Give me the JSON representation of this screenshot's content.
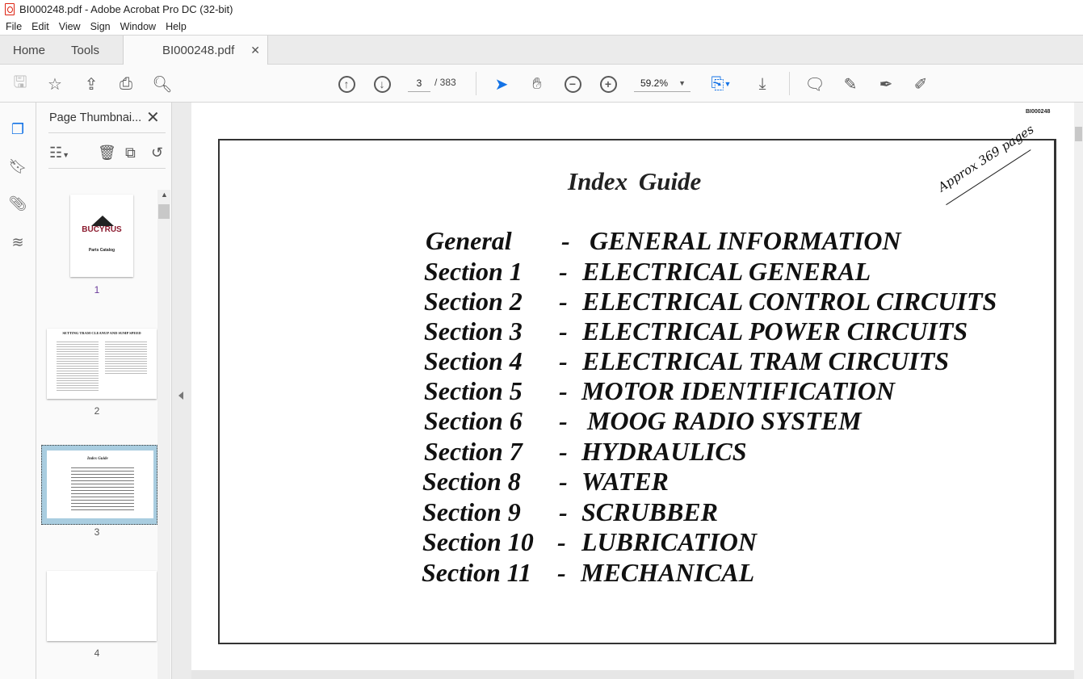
{
  "window": {
    "title": "BI000248.pdf - Adobe Acrobat Pro DC (32-bit)"
  },
  "menu": [
    "File",
    "Edit",
    "View",
    "Sign",
    "Window",
    "Help"
  ],
  "tabs": {
    "home": "Home",
    "tools": "Tools",
    "document": "BI000248.pdf"
  },
  "toolbar": {
    "current_page": "3",
    "total_pages": "/ 383",
    "zoom": "59.2%"
  },
  "panel": {
    "title": "Page Thumbnai...",
    "thumbnails": [
      {
        "label": "1",
        "brand": "BUCYRUS",
        "caption": "Parts Catalog"
      },
      {
        "label": "2",
        "caption": "SETTING TRAM CLEANUP AND SUMP SPEED"
      },
      {
        "label": "3",
        "caption": "Index Guide",
        "selected": true
      },
      {
        "label": "4"
      }
    ]
  },
  "document": {
    "doc_id": "BI000248",
    "handwritten_note": "Approx 369 pages",
    "title": "Index  Guide",
    "entries": [
      {
        "section": "General",
        "dash": "-",
        "name": "GENERAL INFORMATION"
      },
      {
        "section": "Section  1",
        "dash": "-",
        "name": "ELECTRICAL GENERAL"
      },
      {
        "section": "Section  2",
        "dash": "-",
        "name": "ELECTRICAL CONTROL CIRCUITS"
      },
      {
        "section": "Section  3",
        "dash": "-",
        "name": "ELECTRICAL POWER CIRCUITS"
      },
      {
        "section": "Section  4",
        "dash": "-",
        "name": "ELECTRICAL TRAM CIRCUITS"
      },
      {
        "section": "Section  5",
        "dash": "-",
        "name": "MOTOR IDENTIFICATION"
      },
      {
        "section": "Section 6",
        "dash": "-",
        "name": "MOOG RADIO SYSTEM"
      },
      {
        "section": "Section 7",
        "dash": "-",
        "name": "HYDRAULICS"
      },
      {
        "section": "Section 8",
        "dash": "-",
        "name": "WATER"
      },
      {
        "section": "Section 9",
        "dash": "-",
        "name": "SCRUBBER"
      },
      {
        "section": "Section 10",
        "dash": "-",
        "name": "LUBRICATION"
      },
      {
        "section": "Section 11",
        "dash": "-",
        "name": "MECHANICAL"
      }
    ]
  },
  "colors": {
    "accent": "#1473e6",
    "brand": "#8b1a2e",
    "pdf_icon": "#dd2211"
  }
}
